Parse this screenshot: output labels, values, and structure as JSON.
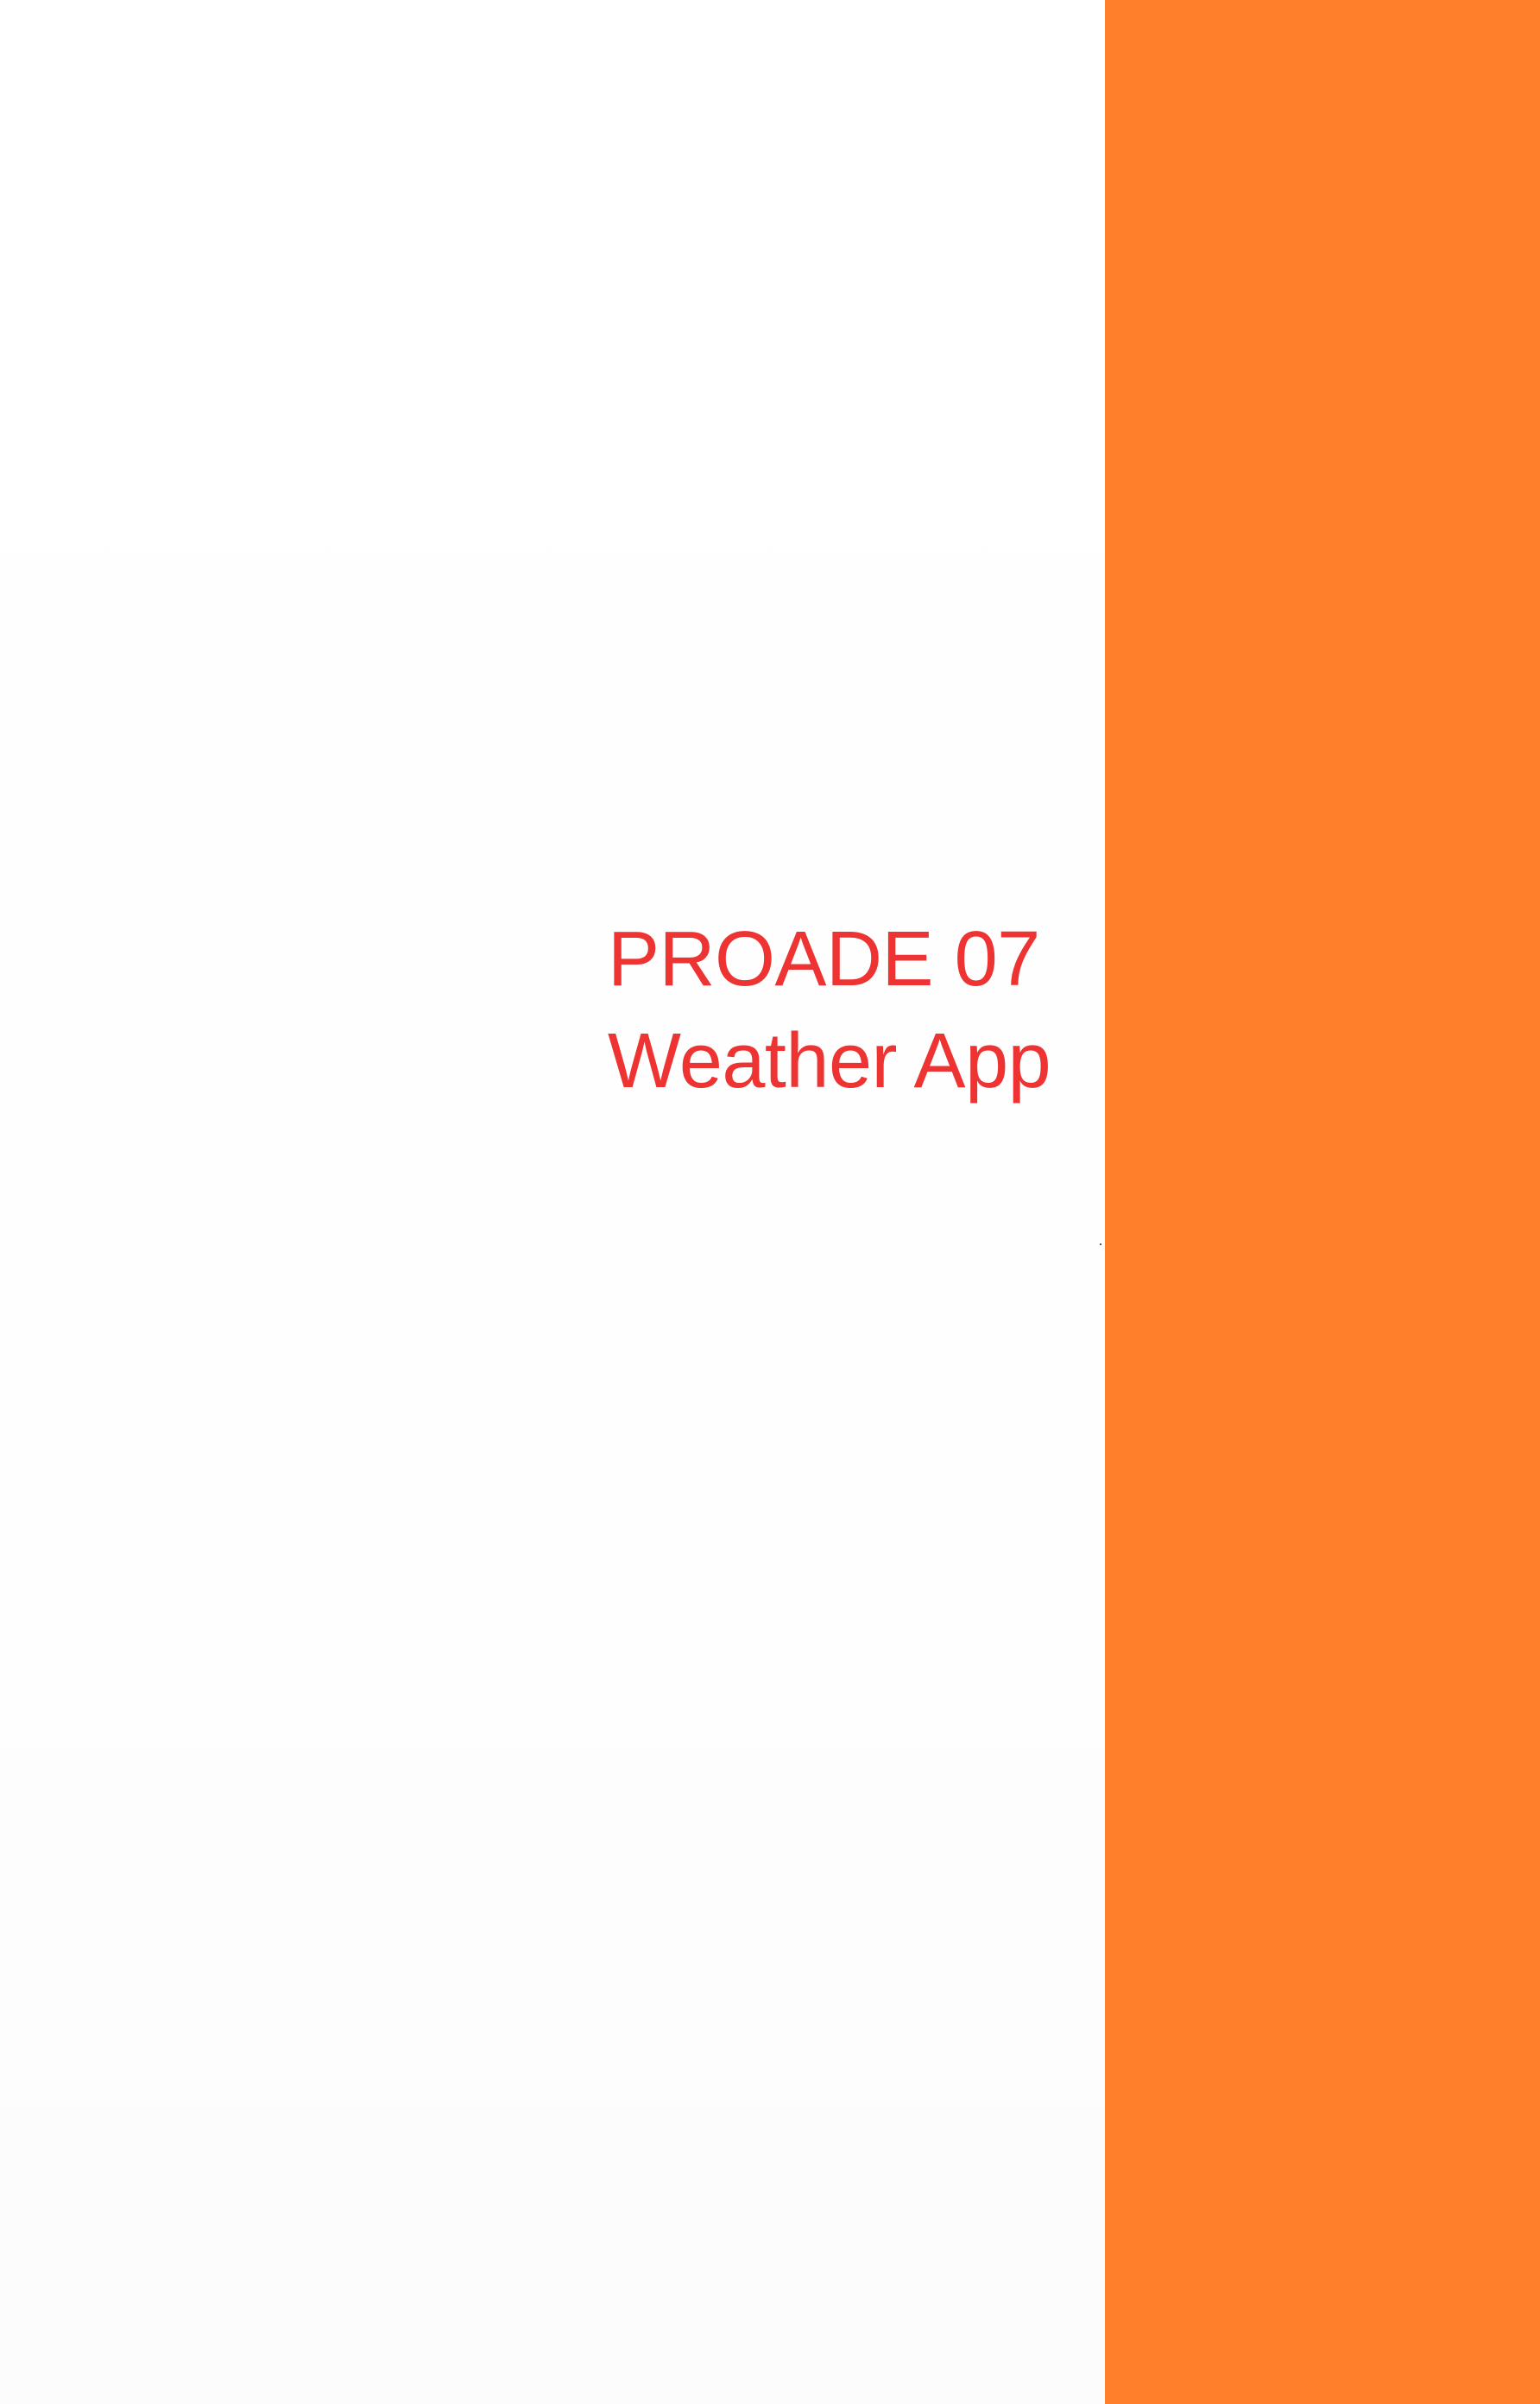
{
  "document": {
    "title_line_1": "PROADE 07",
    "title_line_2": "Weather App"
  },
  "colors": {
    "band": "#FF7F2A",
    "title_text": "#EE3333",
    "background": "#FFFFFF"
  }
}
